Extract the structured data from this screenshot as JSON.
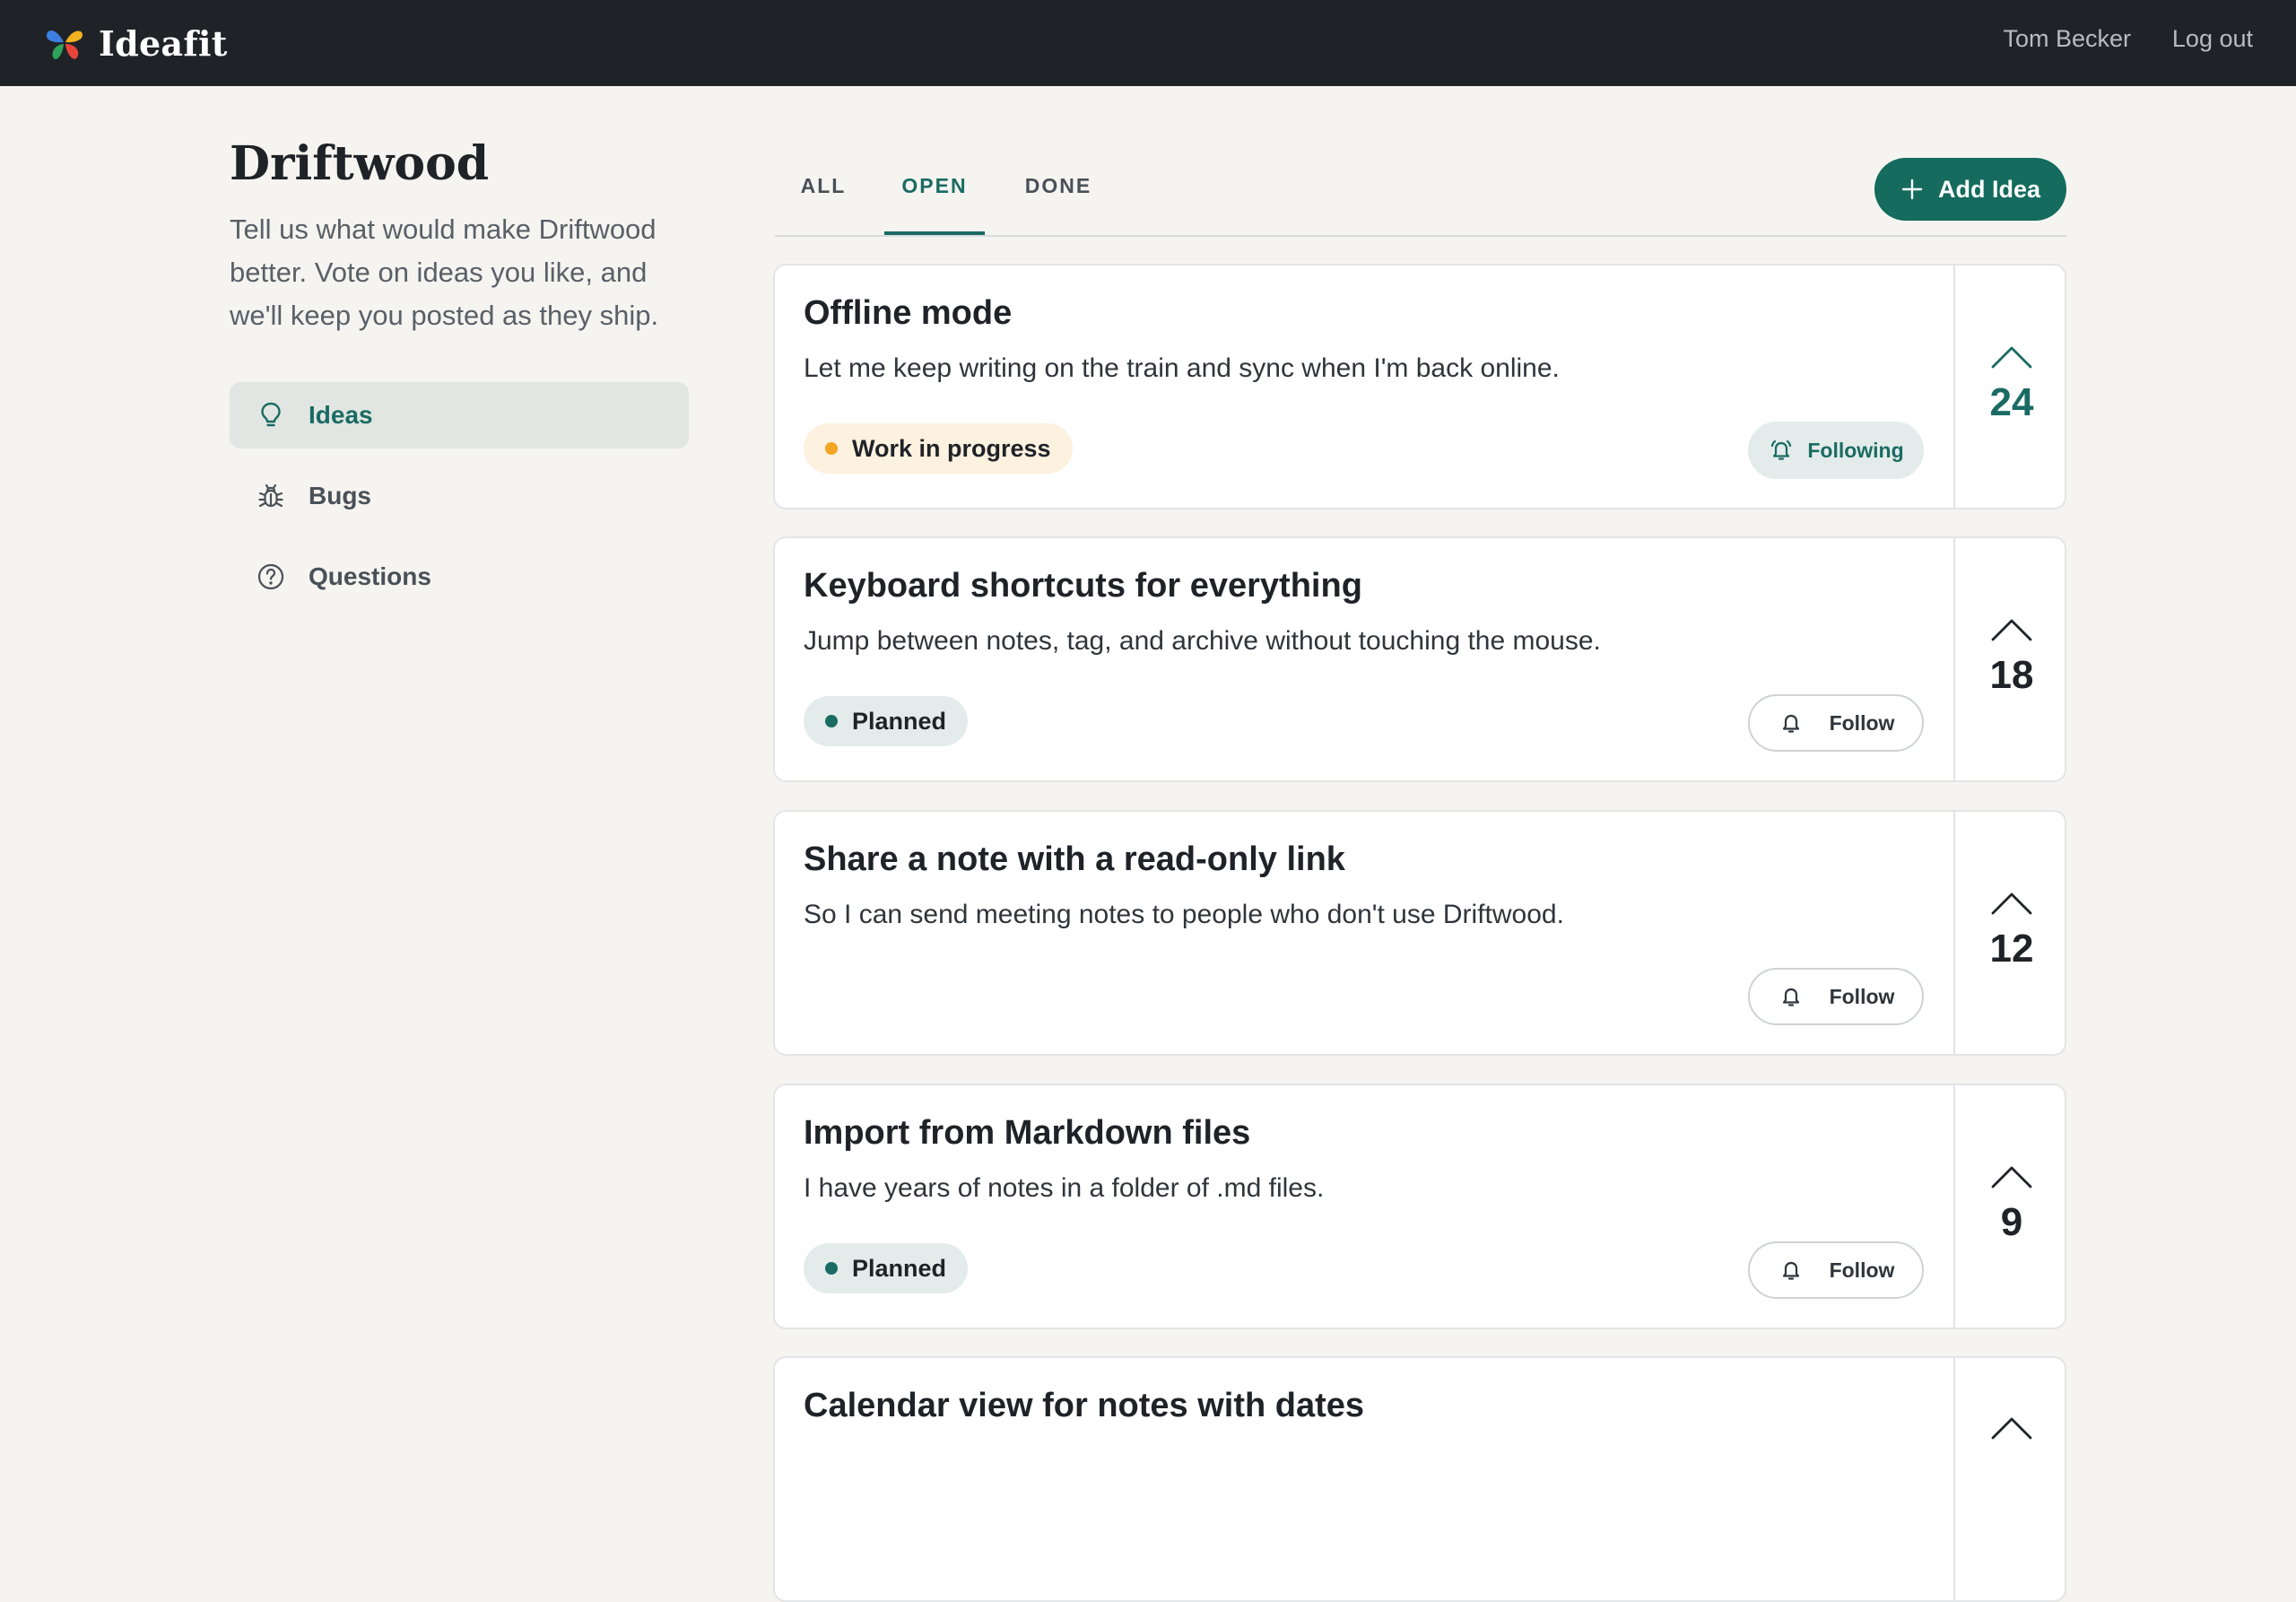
{
  "app": {
    "name": "Ideafit"
  },
  "topbar": {
    "user_name": "Tom Becker",
    "logout_label": "Log out"
  },
  "board": {
    "title": "Driftwood",
    "description": "Tell us what would make Driftwood better. Vote on ideas you like, and we'll keep you posted as they ship."
  },
  "sidebar": {
    "items": [
      {
        "label": "Ideas",
        "icon": "lightbulb-icon",
        "active": true
      },
      {
        "label": "Bugs",
        "icon": "bug-icon",
        "active": false
      },
      {
        "label": "Questions",
        "icon": "question-circle-icon",
        "active": false
      }
    ]
  },
  "tabs": [
    {
      "label": "ALL",
      "active": false
    },
    {
      "label": "OPEN",
      "active": true
    },
    {
      "label": "DONE",
      "active": false
    }
  ],
  "add_idea": {
    "label": "Add Idea",
    "icon": "plus-icon"
  },
  "ideas": [
    {
      "title": "Offline mode",
      "description": "Let me keep writing on the train and sync when I'm back online.",
      "status": "Work in progress",
      "follow_label": "Following",
      "following": true,
      "votes": "24",
      "voted": true
    },
    {
      "title": "Keyboard shortcuts for everything",
      "description": "Jump between notes, tag, and archive without touching the mouse.",
      "status": "Planned",
      "follow_label": "Follow",
      "following": false,
      "votes": "18",
      "voted": false
    },
    {
      "title": "Share a note with a read-only link",
      "description": "So I can send meeting notes to people who don't use Driftwood.",
      "status": "",
      "follow_label": "Follow",
      "following": false,
      "votes": "12",
      "voted": false
    },
    {
      "title": "Import from Markdown files",
      "description": "I have years of notes in a folder of .md files.",
      "status": "Planned",
      "follow_label": "Follow",
      "following": false,
      "votes": "9",
      "voted": false
    },
    {
      "title": "Calendar view for notes with dates",
      "description": "",
      "status": "",
      "follow_label": "",
      "following": false,
      "votes": "",
      "voted": false
    }
  ],
  "colors": {
    "topbar": "#1f2328",
    "accent": "#146b5e",
    "wip": "#f2a623",
    "planned": "#1a6b63",
    "background": "#f5f4f0"
  }
}
